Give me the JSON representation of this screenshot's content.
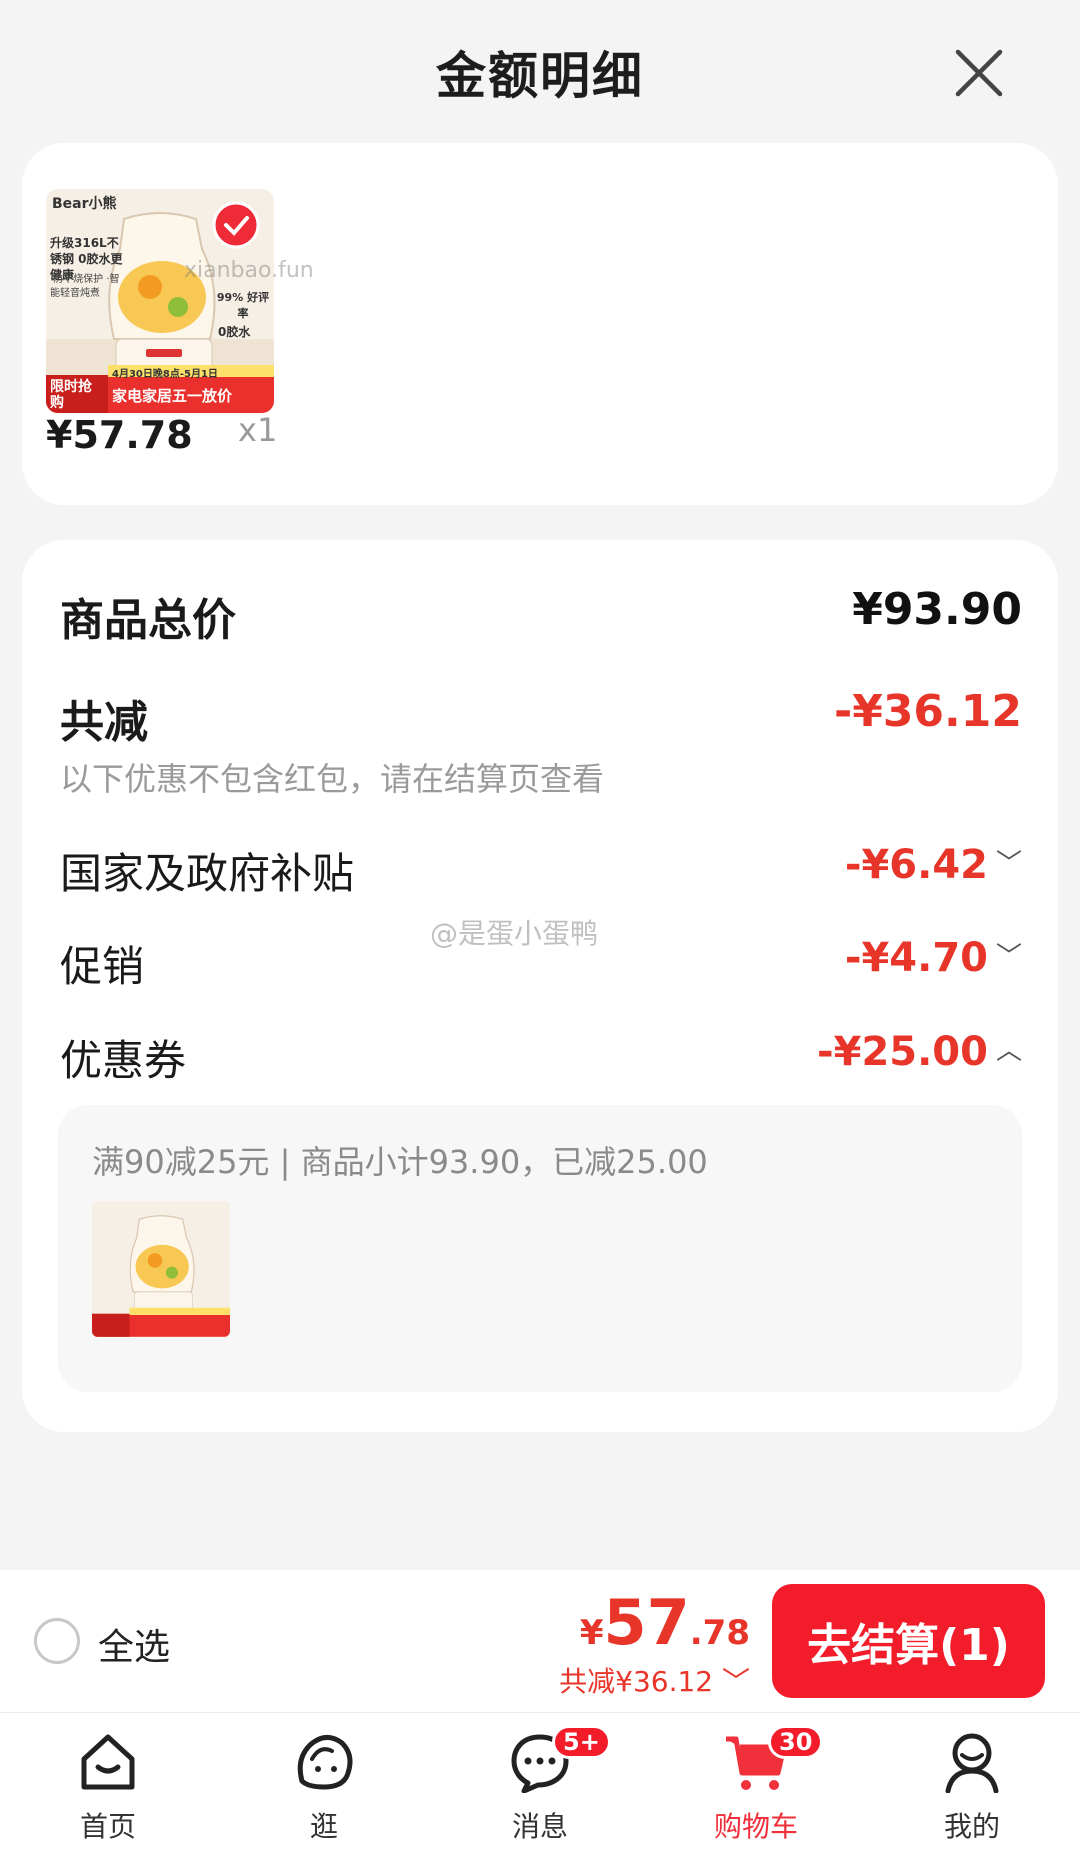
{
  "sheet": {
    "title": "金额明细"
  },
  "product": {
    "price": "¥57.78",
    "qty": "x1",
    "watermark": "xianbao.fun",
    "image": {
      "brand": "Bear小熊",
      "headline": "升级316L不锈钢 0胶水更健康",
      "features": "·防干烧保护 ·智能轻音炖煮",
      "rating": "99% 好评率",
      "tag": "0胶水",
      "date": "4月30日晚8点-5月1日",
      "badge": "限时抢购",
      "promo": "家电家居五一放价"
    }
  },
  "breakdown": {
    "total_label": "商品总价",
    "total_value": "¥93.90",
    "discount_label": "共减",
    "discount_value": "-¥36.12",
    "discount_note": "以下优惠不包含红包，请在结算页查看",
    "items": [
      {
        "label": "国家及政府补贴",
        "value": "-¥6.42",
        "chev": "﹀"
      },
      {
        "label": "促销",
        "value": "-¥4.70",
        "chev": "﹀"
      },
      {
        "label": "优惠券",
        "value": "-¥25.00",
        "chev": "︿"
      }
    ],
    "coupon_detail": "满90减25元 | 商品小计93.90，已减25.00",
    "weibo_watermark": "@是蛋小蛋鸭"
  },
  "checkout": {
    "select_all": "全选",
    "price_symbol": "¥",
    "price_int": "57",
    "price_dec": ".78",
    "saving": "共减¥36.12 ﹀",
    "button": "去结算(1)"
  },
  "tabs": [
    {
      "label": "首页",
      "icon": "home-icon"
    },
    {
      "label": "逛",
      "icon": "browse-icon"
    },
    {
      "label": "消息",
      "icon": "message-icon",
      "badge": "5+"
    },
    {
      "label": "购物车",
      "icon": "cart-icon",
      "badge": "30",
      "active": true
    },
    {
      "label": "我的",
      "icon": "profile-icon"
    }
  ],
  "colors": {
    "accent": "#e8352a",
    "button": "#f21c2b"
  }
}
